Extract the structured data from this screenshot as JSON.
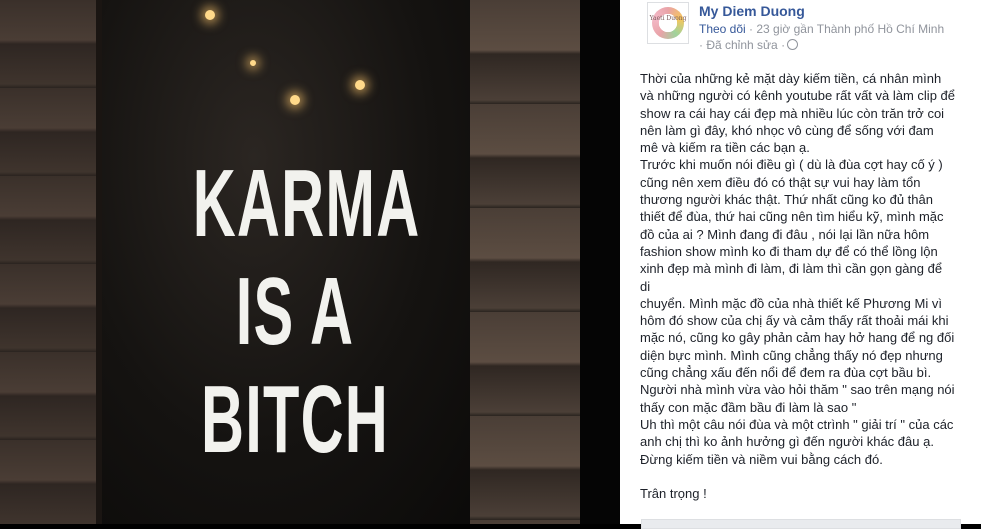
{
  "photo": {
    "sign_lines": [
      "KARMA",
      "IS A",
      "BITCH"
    ]
  },
  "post": {
    "author": "My Diem Duong",
    "avatar_text": "Yaeti Dưong",
    "follow_label": "Theo dõi",
    "time_location": "· 23 giờ gần Thành phố Hồ Chí Minh",
    "edited_label": "· Đã chỉnh sửa ·",
    "privacy_icon": "globe-icon",
    "body_lines": [
      "Thời của những kẻ mặt dày kiếm tiền, cá nhân mình",
      "và những người có kênh youtube rất vất và làm clip để",
      "show ra cái hay cái đẹp mà nhiều lúc còn trăn trở coi",
      "nên làm gì đây, khó nhọc vô cùng để sống với đam",
      "mê và kiếm ra tiền các bạn ạ.",
      "Trước khi muốn nói điều gì ( dù là đùa cợt hay cố ý )",
      "cũng nên xem điều đó có thật sự vui hay làm tổn",
      "thương người khác thật. Thứ nhất cũng ko đủ thân",
      "thiết để đùa, thứ hai cũng nên tìm hiểu kỹ, mình mặc",
      "đồ của ai ? Mình đang đi đâu , nói lại lần nữa hôm",
      "fashion show mình ko đi tham dự để có thể lồng lộn",
      "xinh đẹp mà mình đi làm, đi làm thì cần gọn gàng để di",
      "chuyển. Mình mặc đồ của nhà thiết kế Phương Mi vì",
      "hôm đó show của chị ấy và cảm thấy rất thoải mái khi",
      "mặc nó, cũng ko gây phản cảm hay hở hang để ng đối",
      "diện bực mình. Mình cũng chẳng thấy nó đẹp nhưng",
      "cũng chẳng xấu đến nổi để đem ra đùa cợt bầu bì.",
      "Người nhà mình vừa vào hỏi thăm \" sao trên mạng nói",
      "thấy con mặc đầm bầu đi làm là sao \"",
      "Uh thì một câu nói đùa và một ctrình \" giải trí \" của các",
      "anh chị thì ko ảnh hưởng gì đến người khác đâu ạ.",
      "Đừng kiếm tiền và niềm vui bằng cách đó."
    ],
    "signoff": "Trân trọng !"
  }
}
